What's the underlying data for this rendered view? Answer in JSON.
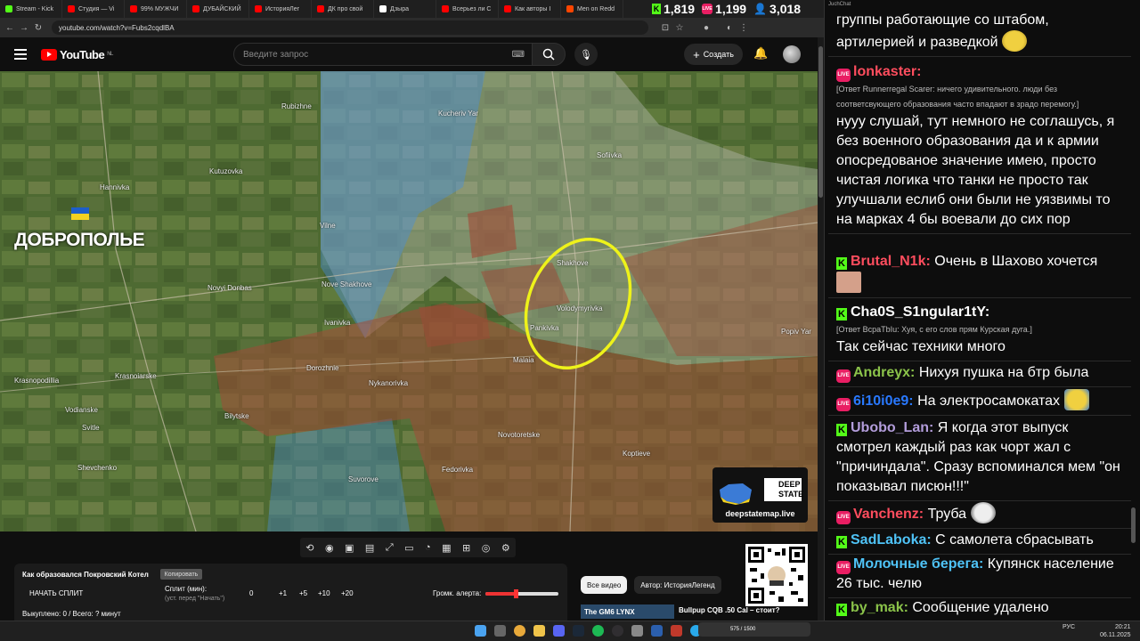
{
  "tabs": [
    {
      "label": "Stream - Kick",
      "color": "#53fc18"
    },
    {
      "label": "Студия — Vi",
      "color": "#ff0000"
    },
    {
      "label": "99% МУЖЧИ",
      "color": "#ff0000"
    },
    {
      "label": "ДУБАЙСКИЙ",
      "color": "#ff0000"
    },
    {
      "label": "ИсторияЛег",
      "color": "#ff0000"
    },
    {
      "label": "ДК про свой",
      "color": "#ff0000"
    },
    {
      "label": "Дзыpa",
      "color": "#ffffff"
    },
    {
      "label": "Всерьез ли С",
      "color": "#ff0000"
    },
    {
      "label": "Как авторы I",
      "color": "#ff0000"
    },
    {
      "label": "Men on Redd",
      "color": "#ff4500"
    }
  ],
  "counters": {
    "kick": "1,819",
    "live": "1,199",
    "viewers": "3,018"
  },
  "address": {
    "url": "youtube.com/watch?v=Fubs2cqdlBA"
  },
  "youtube": {
    "logo": "YouTube",
    "region": "NL",
    "search_placeholder": "Введите запрос",
    "create_label": "Создать"
  },
  "map": {
    "big_city": "ДОБРОПОЛЬЕ",
    "labels": [
      {
        "text": "Rubizhne"
      },
      {
        "text": "Kucheriv Yar"
      },
      {
        "text": "Kutuzovka"
      },
      {
        "text": "Sofiivka"
      },
      {
        "text": "Hannivka"
      },
      {
        "text": "Vilne"
      },
      {
        "text": "Shakhove"
      },
      {
        "text": "Nove Shakhove"
      },
      {
        "text": "Volodymyrivka"
      },
      {
        "text": "Novyi Donbas"
      },
      {
        "text": "Ivanivka"
      },
      {
        "text": "Pankivka"
      },
      {
        "text": "Krasnopodillia"
      },
      {
        "text": "Dorozhnie"
      },
      {
        "text": "Malaia"
      },
      {
        "text": "Krasnoiarske"
      },
      {
        "text": "Nykanorivka"
      },
      {
        "text": "Vodianske"
      },
      {
        "text": "Bilytske"
      },
      {
        "text": "Svitle"
      },
      {
        "text": "Novotoretske"
      },
      {
        "text": "Shevchenko"
      },
      {
        "text": "Suvorove"
      },
      {
        "text": "Fedorivka"
      },
      {
        "text": "Koptieve"
      },
      {
        "text": "Popiv Yar"
      }
    ],
    "badge": {
      "line1": "DEEP",
      "line2": "STATE",
      "url": "deepstatemap.live"
    }
  },
  "controls": {
    "title": "Как образовался Покровский Котел",
    "copy_label": "Копировать",
    "start_split": "НАЧАТЬ СПЛИТ",
    "split_label": "Сплит (мин):",
    "split_sub": "(уст. перед \"Начать\")",
    "zero": "0",
    "increments": [
      "+1",
      "+5",
      "+10",
      "+20"
    ],
    "alert_label": "Громк. алерта:",
    "alert_level": 0.42,
    "status": "Выкуплено: 0 / Всего: ? минут"
  },
  "video_tabs": {
    "all": "Все видео",
    "author": "Автор: ИсторияЛегенд"
  },
  "related": {
    "thumb_text": "The GM6 LYNX",
    "title": "Bullpup CQB .50 Cal – стоит?"
  },
  "chat": {
    "window_title": "JuchChat",
    "messages": [
      {
        "platform": "",
        "name": "",
        "name_color": "#ffffff",
        "reply": "",
        "text": "группы работающие со штабом, артилерией и разведкой",
        "emote": true
      },
      {
        "platform": "live",
        "name": "lonkaster:",
        "name_color": "#ff4d5e",
        "reply": "[Ответ Runnerregal Scarer: ничего удивительного. люди без соответсвующего образования часто впадают в зрадо перемогу.]",
        "text": "нууу слушай, тут немного не соглашусь, я без военного образования да и к армии опосредованое значение имею, просто чистая логика что танки не просто так улучшали еслиб они были не уязвимы то на марках 4 бы воевали до сих пор",
        "emote": false
      },
      {
        "platform": "kick",
        "name": "Brutal_N1k:",
        "name_color": "#ff4d5e",
        "reply": "",
        "text": "Очень в Шахово хочется",
        "emote": true
      },
      {
        "platform": "kick",
        "name": "Cha0S_S1ngular1tY:",
        "name_color": "#ffffff",
        "reply": "[Ответ ВсраТbIu: Хуя, с его слов прям Курская дуга.]",
        "text": "Так сейчас техники много",
        "emote": false
      },
      {
        "platform": "live",
        "name": "Andreyx:",
        "name_color": "#8bc34a",
        "reply": "",
        "text": "Нихуя пушка на бтр была",
        "emote": false
      },
      {
        "platform": "live",
        "name": "6i10i0e9:",
        "name_color": "#2979ff",
        "reply": "",
        "text": "На электросамокатах",
        "emote": true
      },
      {
        "platform": "kick",
        "name": "Ubobo_Lan:",
        "name_color": "#b39ddb",
        "reply": "",
        "text": "Я когда этот выпуск смотрел каждый раз как чорт жал с \"причиндала\". Сразу вспоминался мем \"он показывал писюн!!!\"",
        "emote": false
      },
      {
        "platform": "live",
        "name": "Vanchenz:",
        "name_color": "#ff4d5e",
        "reply": "",
        "text": "Труба",
        "emote": true
      },
      {
        "platform": "kick",
        "name": "SadLaboka:",
        "name_color": "#4fc3f7",
        "reply": "",
        "text": "С самолета сбрасывать",
        "emote": false
      },
      {
        "platform": "live",
        "name": "Молочные берега:",
        "name_color": "#4fc3f7",
        "reply": "",
        "text": "Купянск население 26 тыс. челю",
        "emote": false
      },
      {
        "platform": "kick",
        "name": "by_mak:",
        "name_color": "#8bc34a",
        "reply": "",
        "text": "Сообщение удалено",
        "emote": false
      }
    ]
  },
  "taskbar": {
    "lang": "РУС",
    "time": "20:21",
    "date": "06.11.2025",
    "pill": "575 / 1500"
  }
}
